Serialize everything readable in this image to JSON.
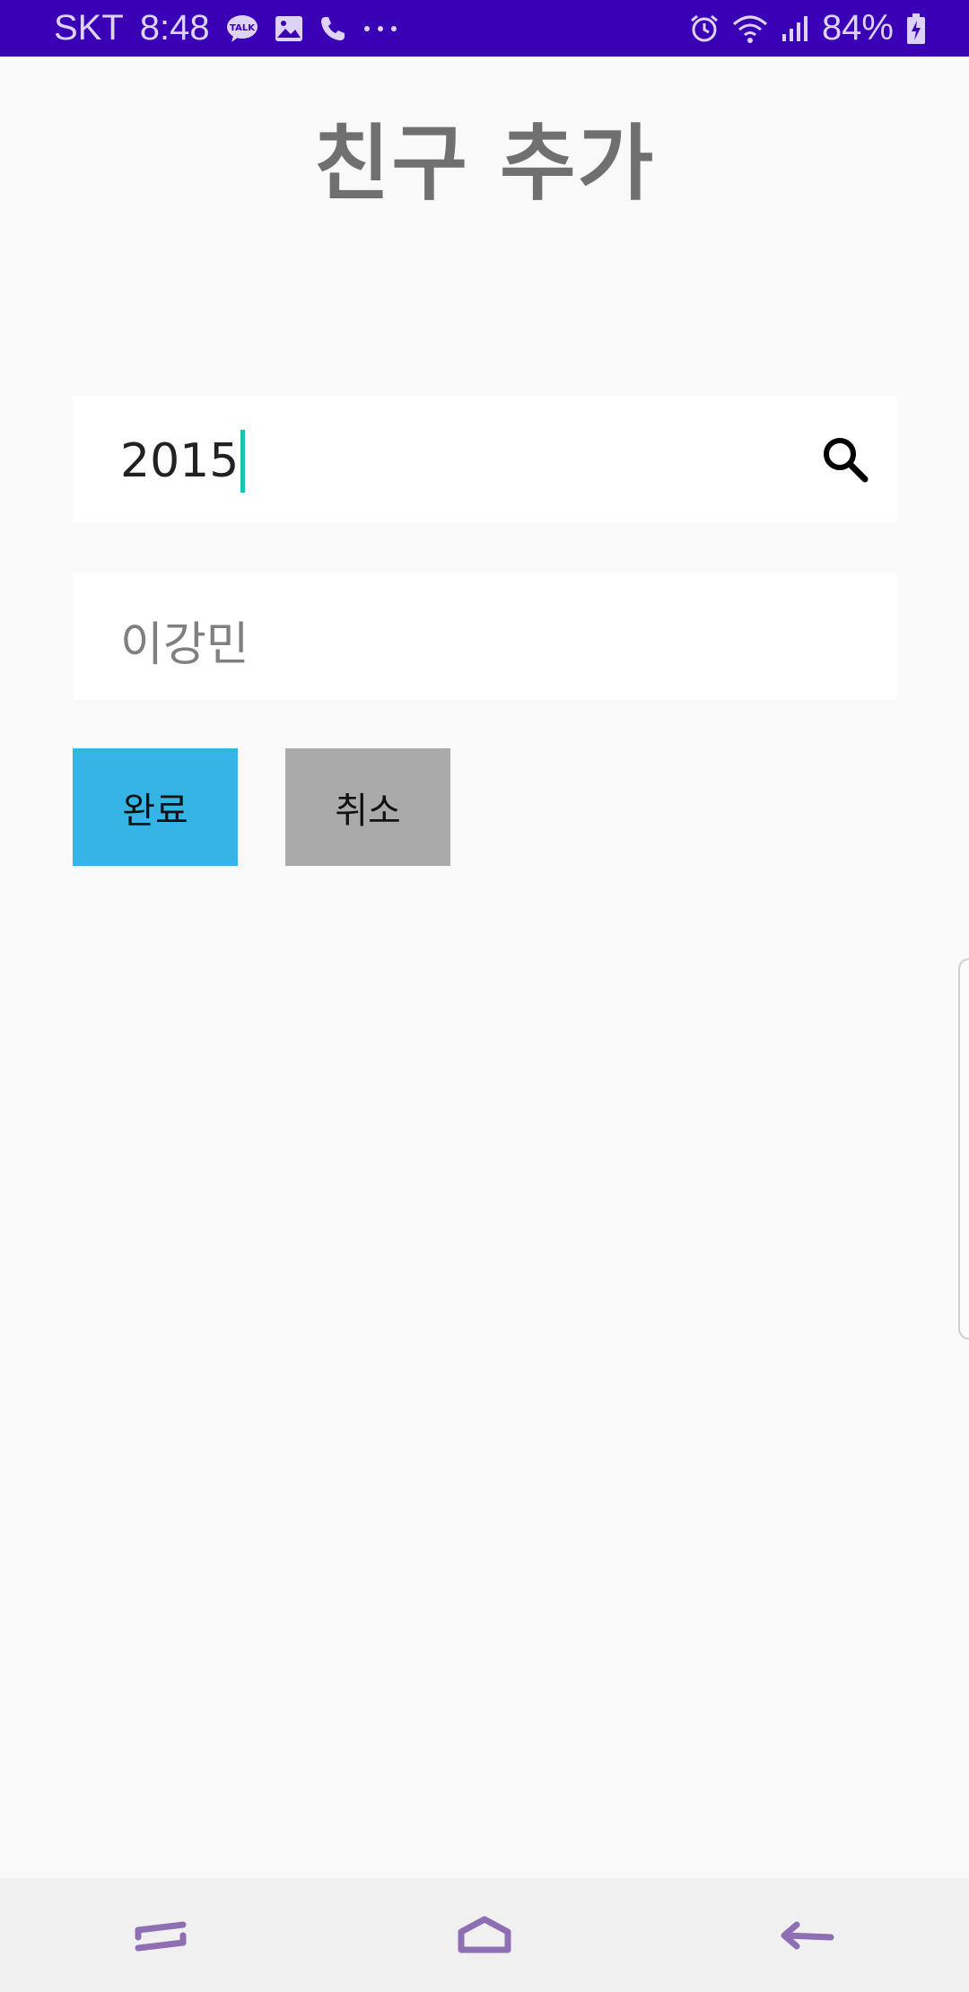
{
  "status_bar": {
    "carrier": "SKT",
    "time": "8:48",
    "battery_percent": "84%",
    "left_icons": [
      "talk-icon",
      "gallery-icon",
      "phone-icon",
      "more-dots-icon"
    ],
    "right_icons": [
      "alarm-icon",
      "wifi-icon",
      "signal-icon",
      "battery-charging-icon"
    ],
    "background": "#3a00b5"
  },
  "page": {
    "title": "친구 추가"
  },
  "search_field": {
    "value": "2015",
    "icon": "search-icon"
  },
  "name_field": {
    "value": "이강민"
  },
  "buttons": {
    "done_label": "완료",
    "cancel_label": "취소",
    "done_color": "#35b5e6",
    "cancel_color": "#aaaaaa"
  },
  "nav_bar": {
    "items": [
      "recent-apps-icon",
      "home-icon",
      "back-icon"
    ],
    "icon_color": "#8e6fb3"
  }
}
